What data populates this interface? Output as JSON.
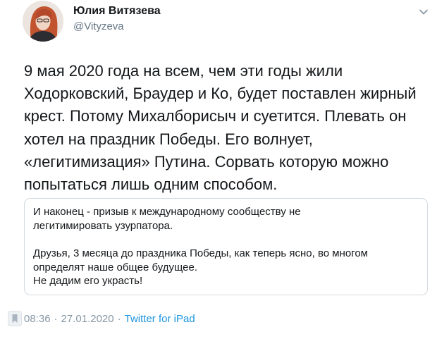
{
  "author": {
    "display_name": "Юлия Витязева",
    "handle": "@Vityzeva"
  },
  "tweet": {
    "text": "9 мая 2020 года на всем, чем эти годы жили\nХодорковский, Браудер и Ко, будет поставлен жирный\nкрест. Потому Михалборисыч и суетится. Плевать он\nхотел на праздник Победы. Его волнует,\n«легитимизация» Путина. Сорвать которую можно\nпопытаться лишь одним способом."
  },
  "quote": {
    "paragraph_1": "И наконец - призыв к международному сообществу не\nлегитимировать узурпатора.",
    "paragraph_2": "Друзья, 3 месяца до праздника Победы, как теперь ясно, во многом\nопределят наше общее будущее.\nНе дадим его украсть!"
  },
  "meta": {
    "time": "08:36",
    "separator": "·",
    "date": "27.01.2020",
    "source": "Twitter for iPad"
  },
  "icons": {
    "avatar": "avatar",
    "menu": "chevron-down-icon",
    "bookmark": "bookmark-icon"
  },
  "colors": {
    "text": "#14171a",
    "secondary": "#657786",
    "link": "#1b95e0",
    "border": "#d3d9de"
  }
}
